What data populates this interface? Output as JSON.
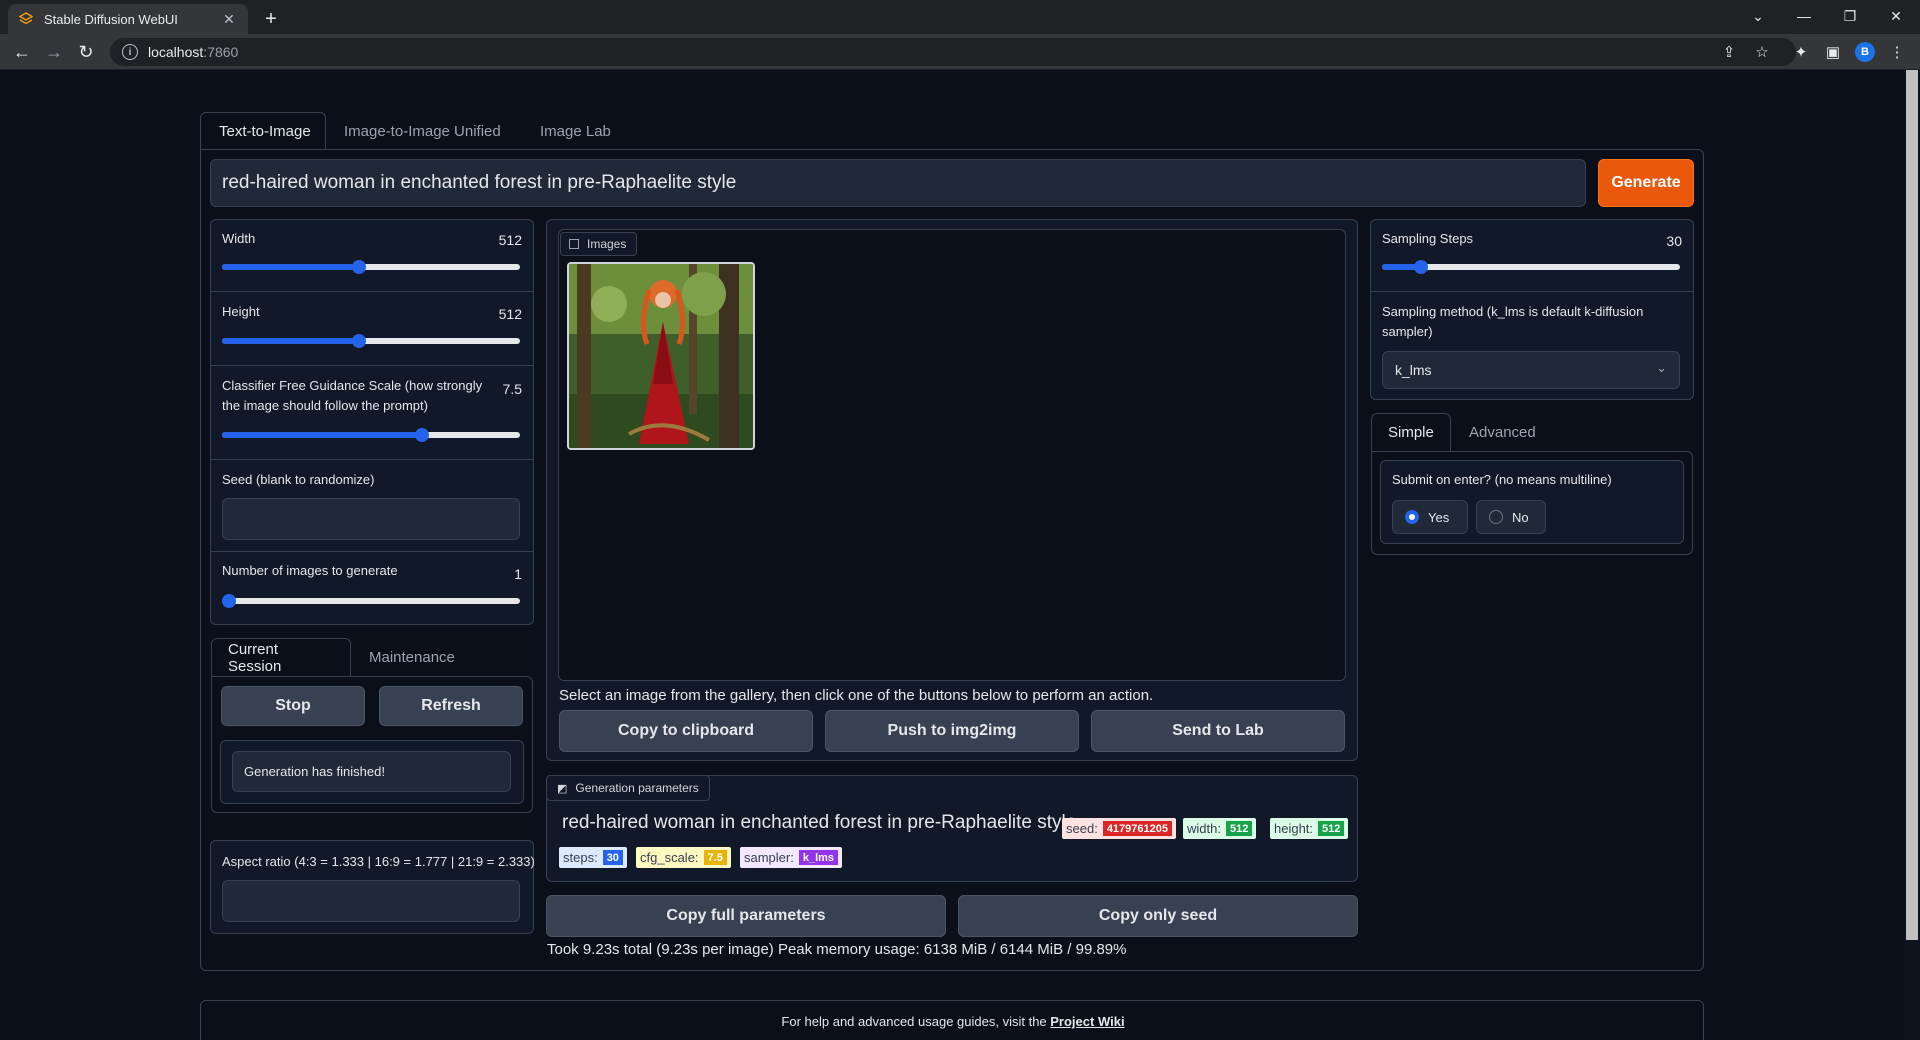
{
  "browser": {
    "tab_title": "Stable Diffusion WebUI",
    "url_host": "localhost",
    "url_port": ":7860",
    "profile_initial": "B"
  },
  "main_tabs": [
    "Text-to-Image",
    "Image-to-Image Unified",
    "Image Lab"
  ],
  "prompt": "red-haired woman in enchanted forest in pre-Raphaelite style",
  "generate_label": "Generate",
  "left_panel": {
    "width": {
      "label": "Width",
      "value": "512",
      "fraction": 0.46
    },
    "height": {
      "label": "Height",
      "value": "512",
      "fraction": 0.46
    },
    "cfg": {
      "label": "Classifier Free Guidance Scale (how strongly the image should follow the prompt)",
      "value": "7.5",
      "fraction": 0.67
    },
    "seed": {
      "label": "Seed (blank to randomize)",
      "value": ""
    },
    "num_images": {
      "label": "Number of images to generate",
      "value": "1",
      "fraction": 0.0
    }
  },
  "session_tabs": [
    "Current Session",
    "Maintenance"
  ],
  "session": {
    "stop_label": "Stop",
    "refresh_label": "Refresh",
    "status": "Generation has finished!"
  },
  "aspect": {
    "label": "Aspect ratio (4:3 = 1.333 | 16:9 = 1.777 | 21:9 = 2.333)",
    "value": ""
  },
  "gallery": {
    "label": "Images",
    "hint": "Select an image from the gallery, then click one of the buttons below to perform an action.",
    "buttons": [
      "Copy to clipboard",
      "Push to img2img",
      "Send to Lab"
    ]
  },
  "gen_params": {
    "label": "Generation parameters",
    "prompt": "red-haired woman in enchanted forest in pre-Raphaelite style",
    "badges": [
      {
        "key": "seed:",
        "value": "4179761205",
        "color": "#dc2626",
        "bg": "#fee2e2"
      },
      {
        "key": "width:",
        "value": "512",
        "color": "#16a34a",
        "bg": "#dcfce7"
      },
      {
        "key": "height:",
        "value": "512",
        "color": "#16a34a",
        "bg": "#dcfce7"
      },
      {
        "key": "steps:",
        "value": "30",
        "color": "#2563eb",
        "bg": "#dbeafe"
      },
      {
        "key": "cfg_scale:",
        "value": "7.5",
        "color": "#eab308",
        "bg": "#fef9c3"
      },
      {
        "key": "sampler:",
        "value": "k_lms",
        "color": "#9333ea",
        "bg": "#f3e8ff"
      }
    ]
  },
  "copy_buttons": [
    "Copy full parameters",
    "Copy only seed"
  ],
  "timing": "Took 9.23s total (9.23s per image) Peak memory usage: 6138 MiB / 6144 MiB / 99.89%",
  "right_panel": {
    "steps": {
      "label": "Sampling Steps",
      "value": "30",
      "fraction": 0.13
    },
    "sampler": {
      "label": "Sampling method (k_lms is default k-diffusion sampler)",
      "value": "k_lms"
    },
    "mode_tabs": [
      "Simple",
      "Advanced"
    ],
    "submit": {
      "label": "Submit on enter? (no means multiline)",
      "options": [
        "Yes",
        "No"
      ],
      "selected": "Yes"
    }
  },
  "footer": {
    "text": "For help and advanced usage guides, visit the ",
    "link": "Project Wiki"
  },
  "colors": {
    "accent": "#ea580c",
    "slider": "#2563eb",
    "background": "#0b0f19"
  }
}
